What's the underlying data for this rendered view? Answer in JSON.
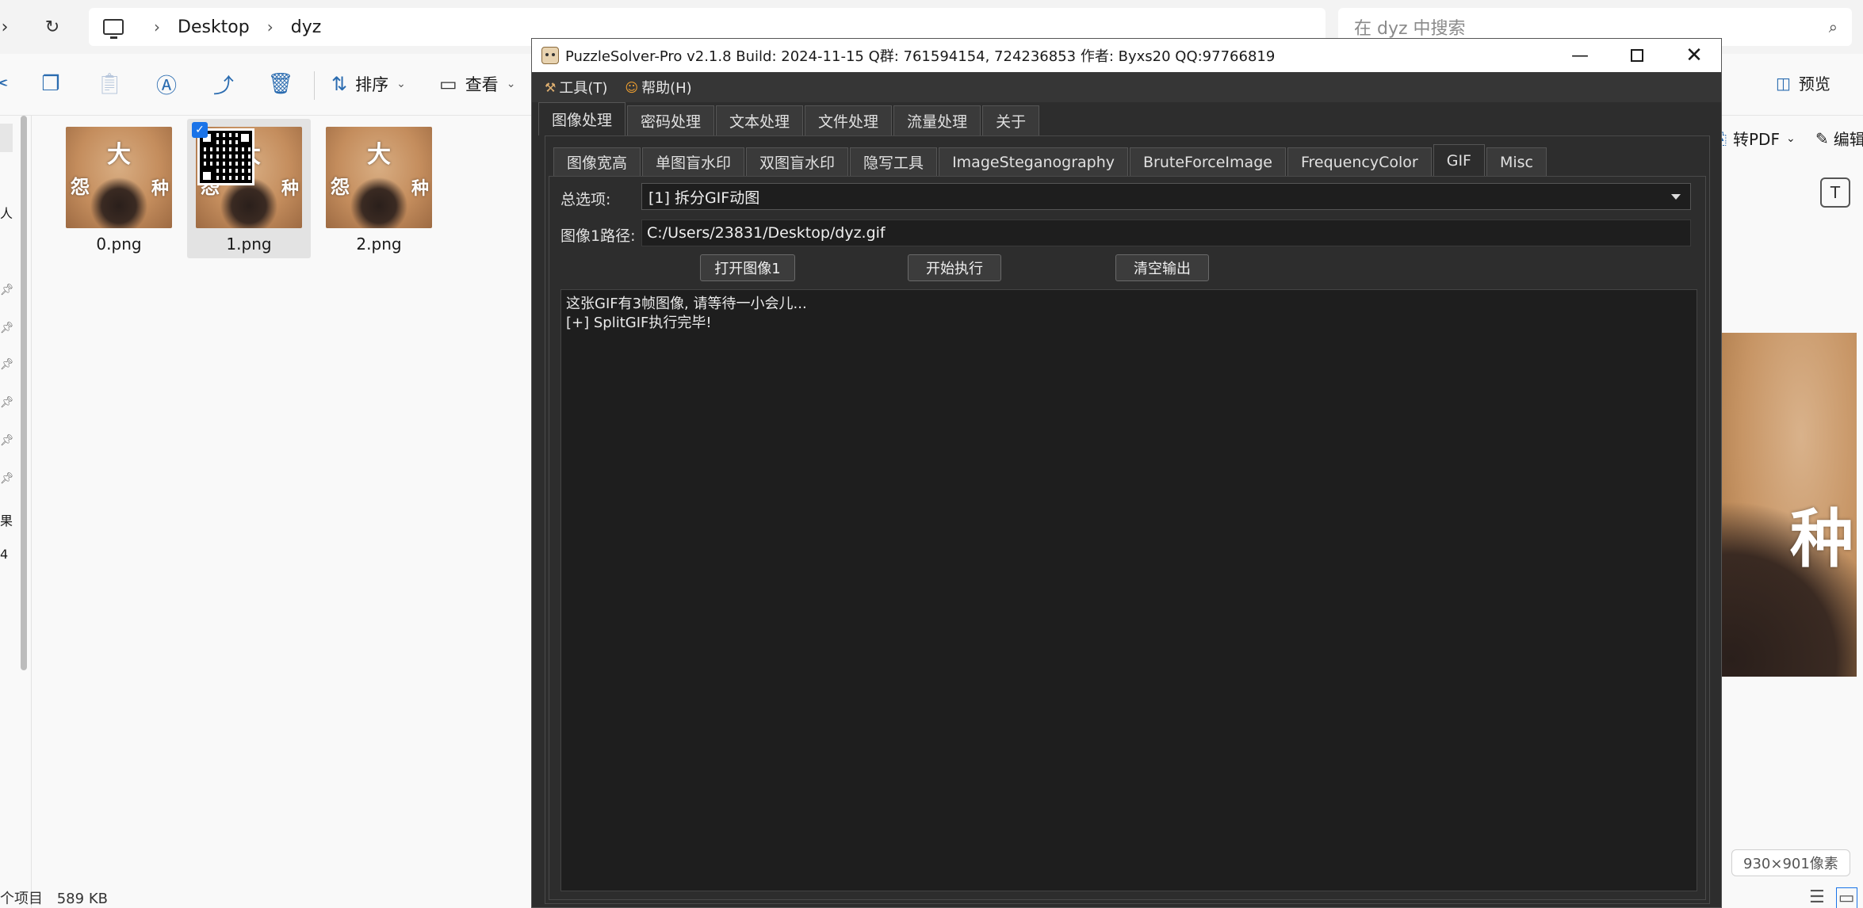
{
  "explorer": {
    "breadcrumb": [
      "Desktop",
      "dyz"
    ],
    "search_placeholder": "在 dyz 中搜索",
    "toolbar": {
      "sort_label": "排序",
      "view_label": "查看",
      "preview_label": "预览",
      "topdf_label": "转PDF",
      "edit_label": "编辑"
    },
    "files": [
      {
        "name": "0.png",
        "chars": [
          "大",
          "怨",
          "种"
        ]
      },
      {
        "name": "1.png",
        "chars": [
          "大",
          "怨",
          "种"
        ]
      },
      {
        "name": "2.png",
        "chars": [
          "大",
          "怨",
          "种"
        ]
      }
    ],
    "status": {
      "count": "个项目",
      "size": "589 KB"
    },
    "preview": {
      "char": "种",
      "dimensions": "930×901像素"
    },
    "left_fragments": [
      "人",
      "果",
      "4"
    ]
  },
  "puzzlesolver": {
    "title": "PuzzleSolver-Pro v2.1.8  Build: 2024-11-15  Q群:  761594154, 724236853  作者:  Byxs20  QQ:97766819",
    "menu": [
      {
        "label": "工具(T)",
        "icon": "tools-icon"
      },
      {
        "label": "帮助(H)",
        "icon": "help-icon"
      }
    ],
    "main_tabs": [
      "图像处理",
      "密码处理",
      "文本处理",
      "文件处理",
      "流量处理",
      "关于"
    ],
    "active_main_tab": 0,
    "sub_tabs": [
      "图像宽高",
      "单图盲水印",
      "双图盲水印",
      "隐写工具",
      "ImageSteganography",
      "BruteForceImage",
      "FrequencyColor",
      "GIF",
      "Misc"
    ],
    "active_sub_tab": 7,
    "option_label": "总选项:",
    "option_value": "[1] 拆分GIF动图",
    "path_label": "图像1路径:",
    "path_value": "C:/Users/23831/Desktop/dyz.gif",
    "buttons": {
      "open": "打开图像1",
      "run": "开始执行",
      "clear": "清空输出"
    },
    "output_lines": [
      "这张GIF有3帧图像, 请等待一小会儿...",
      "[+] SplitGIF执行完毕!"
    ]
  },
  "colors": {
    "dark_bg": "#2d2d2d",
    "accent": "#1a73e8"
  }
}
